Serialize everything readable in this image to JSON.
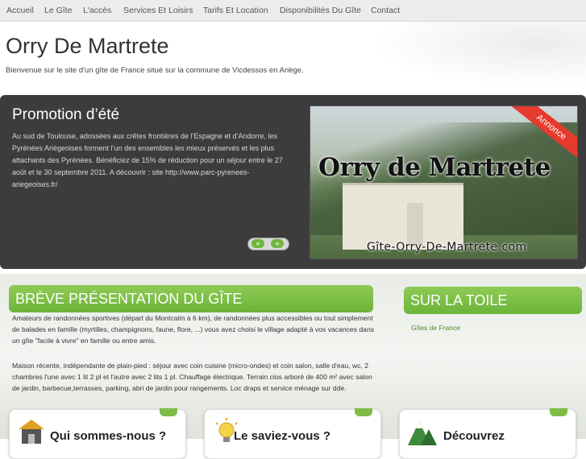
{
  "nav": {
    "items": [
      {
        "label": "Accueil"
      },
      {
        "label": "Le Gîte"
      },
      {
        "label": "L'accès"
      },
      {
        "label": "Services Et Loisirs"
      },
      {
        "label": "Tarifs Et Location"
      },
      {
        "label": "Disponibilités Du Gîte"
      },
      {
        "label": "Contact"
      }
    ]
  },
  "header": {
    "title": "Orry De Martrete",
    "subtitle": "Bienvenue sur le site d'un gîte de France situé sur la commune de Vicdessos en Ariège."
  },
  "promo": {
    "title": "Promotion d’été",
    "text": "Au sud de Toulouse, adossées aux crêtes frontières de l’Espagne et d’Andorre, les Pyrénées Ariégeoises forment l’un des ensembles les mieux préservés et les plus attachants des Pyrénées. Bénéficiez de 15% de réduction pour un séjour entre le 27 août et le 30 septembre 2011. A découvrir : site http://www.parc-pyrenees-ariegeoises.fr/",
    "prev_arrow": "«",
    "next_arrow": "»",
    "image": {
      "overlay_title": "Orry de Martrete",
      "overlay_url": "Gîte-Orry-De-Martrete.com",
      "ribbon": "Annonce"
    }
  },
  "presentation": {
    "title": "BRÈVE PRÉSENTATION DU GÎTE",
    "paragraph1": "Amateurs de randonnées sportives (départ du Montcalm à 6 km), de randonnées plus accessibles ou tout simplement de balades en famille (myrtilles, champignons, faune, flore, ...) vous avez choisi le village adapté à vos vacances dans un gîte \"facile à vivre\" en famille ou entre amis.",
    "paragraph2": "Maison récente, indépendante de plain-pied : séjour avec coin cuisine (micro-ondes) et coin salon, salle d'eau, wc, 2 chambres l'une avec 1 lit 2 pl et l'autre avec 2 lits 1 pl. Chauffage électrique. Terrain clos arboré de 400 m² avec salon de jardin, barbecue,terrasses, parking, abri de jardin pour rangements. Loc draps et service ménage sur dde."
  },
  "toile": {
    "title": "SUR LA TOILE",
    "link": "Gîtes de France"
  },
  "cards": [
    {
      "title": "Qui sommes-nous ?"
    },
    {
      "title": "Le saviez-vous ?"
    },
    {
      "title": "Découvrez"
    }
  ],
  "colors": {
    "accent_green": "#7dbd47",
    "promo_bg": "#3c3c3c",
    "ribbon_red": "#e53a2d"
  }
}
